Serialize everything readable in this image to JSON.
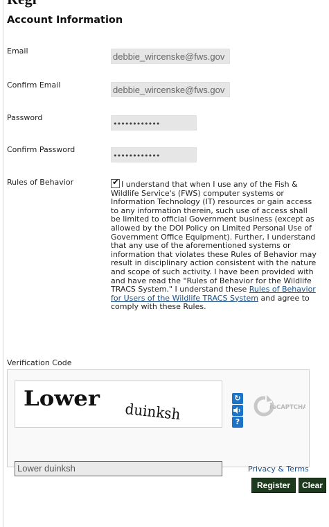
{
  "header": {
    "clipped_title": "Regi",
    "section_title": "Account Information"
  },
  "fields": {
    "email": {
      "label": "Email",
      "value": "debbie_wircenske@fws.gov"
    },
    "confirm_email": {
      "label": "Confirm Email",
      "value": "debbie_wircenske@fws.gov"
    },
    "password": {
      "label": "Password",
      "value": "••••••••••••"
    },
    "confirm_password": {
      "label": "Confirm Password",
      "value": "••••••••••••"
    }
  },
  "rules": {
    "label": "Rules of Behavior",
    "checked": true,
    "text_before_link": "I understand that when I use any of the Fish & Wildlife Service's (FWS) computer systems or Information Technology (IT) resources or gain access to any information therein, such use of access shall be limited to official Government business (except as allowed by the DOI Policy on Limited Personal Use of Government Office Equipment). Further, I understand that any use of the aforementioned systems or information that violates these Rules of Behavior may result in disciplinary action consistent with the nature and scope of such activity. I have been provided with and have read the \"Rules of Behavior for the Wildlife TRACS System.\" I understand these ",
    "link_text": "Rules of Behavior for Users of the Wildlife TRACS System",
    "text_after_link": " and agree to comply with these Rules."
  },
  "captcha": {
    "label": "Verification Code",
    "word1": "Lower",
    "word2": "duinksh",
    "input_value": "Lower duinksh",
    "privacy_link": "Privacy & Terms",
    "refresh_icon": "refresh-icon",
    "audio_icon": "audio-icon",
    "help_icon": "help-icon",
    "logo_text": "reCAPTCHA™"
  },
  "buttons": {
    "register": "Register",
    "clear": "Clear"
  },
  "colors": {
    "button_bg": "#1d3a1e",
    "link": "#1a4f8a",
    "captcha_icon_bg": "#1d74c6"
  }
}
